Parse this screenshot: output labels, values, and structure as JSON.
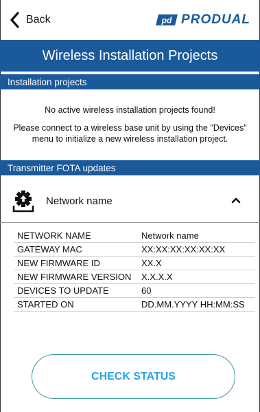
{
  "header": {
    "back_label": "Back",
    "brand": "PRODUAL"
  },
  "title": "Wireless Installation Projects",
  "installation": {
    "section_title": "Installation projects",
    "empty_message": "No active wireless installation projects found!",
    "instructions": "Please connect to a wireless base unit by using the \"Devices\" menu to initialize a new wireless installation project."
  },
  "fota": {
    "section_title": "Transmitter FOTA updates",
    "network_label": "Network name",
    "expanded": true,
    "details": [
      {
        "label": "NETWORK NAME",
        "value": "Network name"
      },
      {
        "label": "GATEWAY MAC",
        "value": "XX:XX:XX:XX:XX:XX"
      },
      {
        "label": "NEW FIRMWARE ID",
        "value": "XX.X"
      },
      {
        "label": "NEW FIRMWARE VERSION",
        "value": "X.X.X.X"
      },
      {
        "label": "DEVICES TO UPDATE",
        "value": "60"
      },
      {
        "label": "STARTED ON",
        "value": "DD.MM.YYYY  HH:MM:SS"
      }
    ]
  },
  "actions": {
    "check_status_label": "CHECK STATUS"
  },
  "colors": {
    "brand_blue": "#1b5a9a",
    "button_text": "#27a3e2",
    "button_border": "#3a9a9c"
  },
  "icons": {
    "back": "chevron-left-icon",
    "network": "gear-upload-icon",
    "collapse": "chevron-up-icon"
  }
}
